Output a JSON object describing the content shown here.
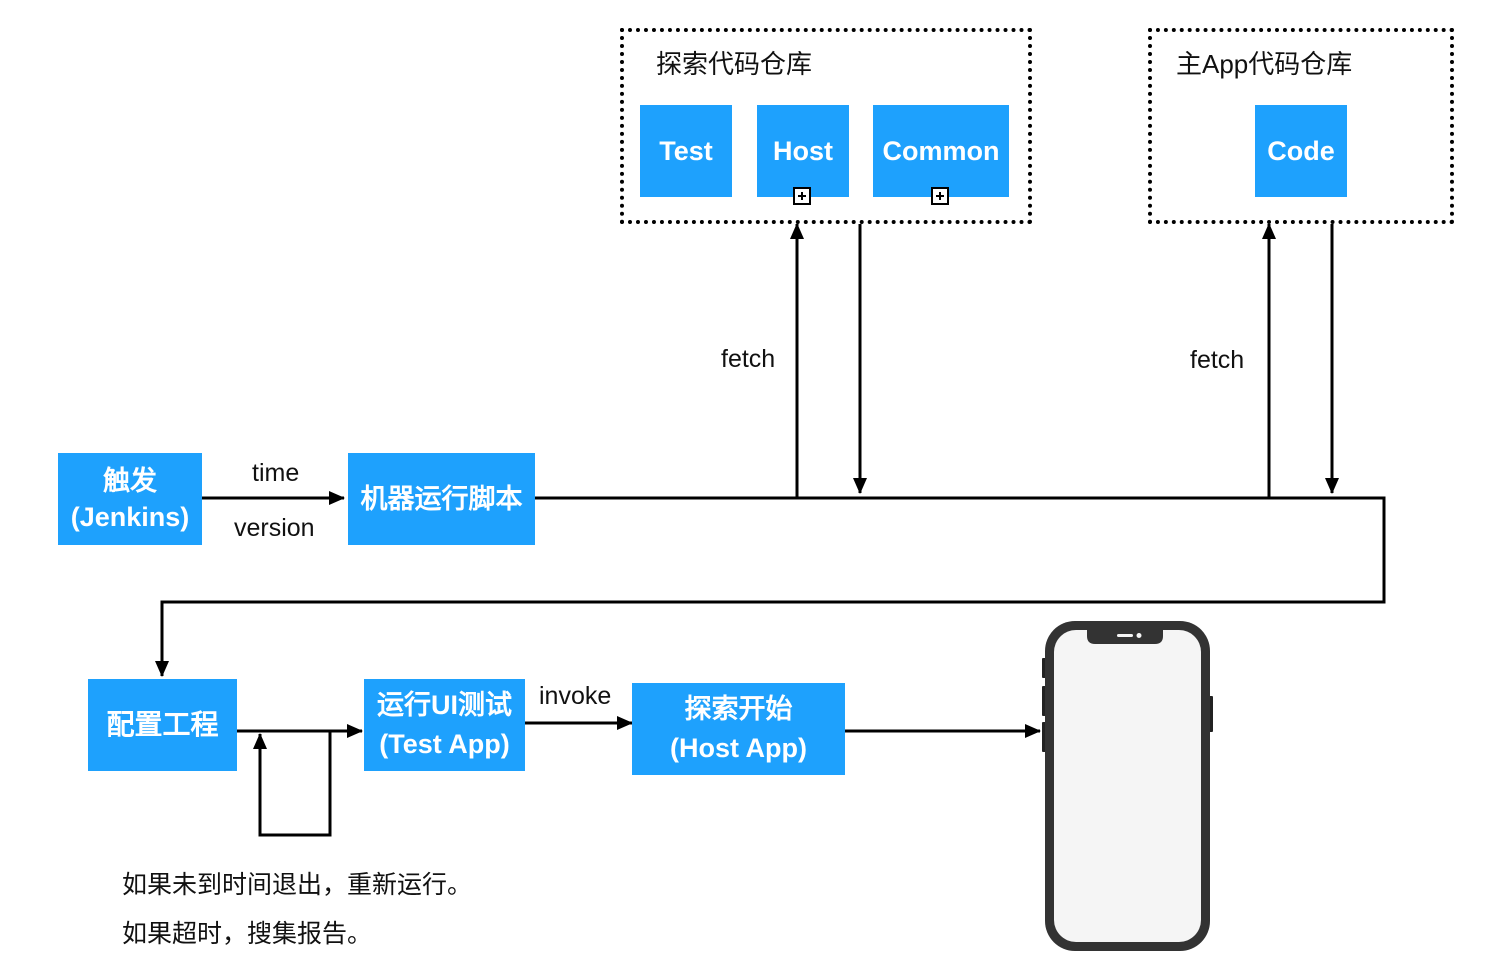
{
  "colors": {
    "node_fill": "#1ea1fd",
    "node_text": "#ffffff",
    "line": "#000000",
    "phone_frame": "#333333",
    "phone_screen": "#f5f5f5"
  },
  "groups": {
    "explore_repo": {
      "title": "探索代码仓库",
      "nodes": {
        "test": "Test",
        "host": "Host",
        "common": "Common"
      }
    },
    "main_repo": {
      "title": "主App代码仓库",
      "nodes": {
        "code": "Code"
      }
    }
  },
  "nodes": {
    "trigger": {
      "line1": "触发",
      "line2": "(Jenkins)"
    },
    "script": {
      "line1": "机器运行脚本"
    },
    "config": {
      "line1": "配置工程"
    },
    "ui_test": {
      "line1": "运行UI测试",
      "line2": "(Test App)"
    },
    "explore": {
      "line1": "探索开始",
      "line2": "(Host App)"
    }
  },
  "edge_labels": {
    "time": "time",
    "version": "version",
    "fetch_explore": "fetch",
    "fetch_main": "fetch",
    "invoke": "invoke"
  },
  "notes": {
    "line1": "如果未到时间退出，重新运行。",
    "line2": "如果超时，搜集报告。"
  },
  "device": {
    "type": "smartphone"
  }
}
